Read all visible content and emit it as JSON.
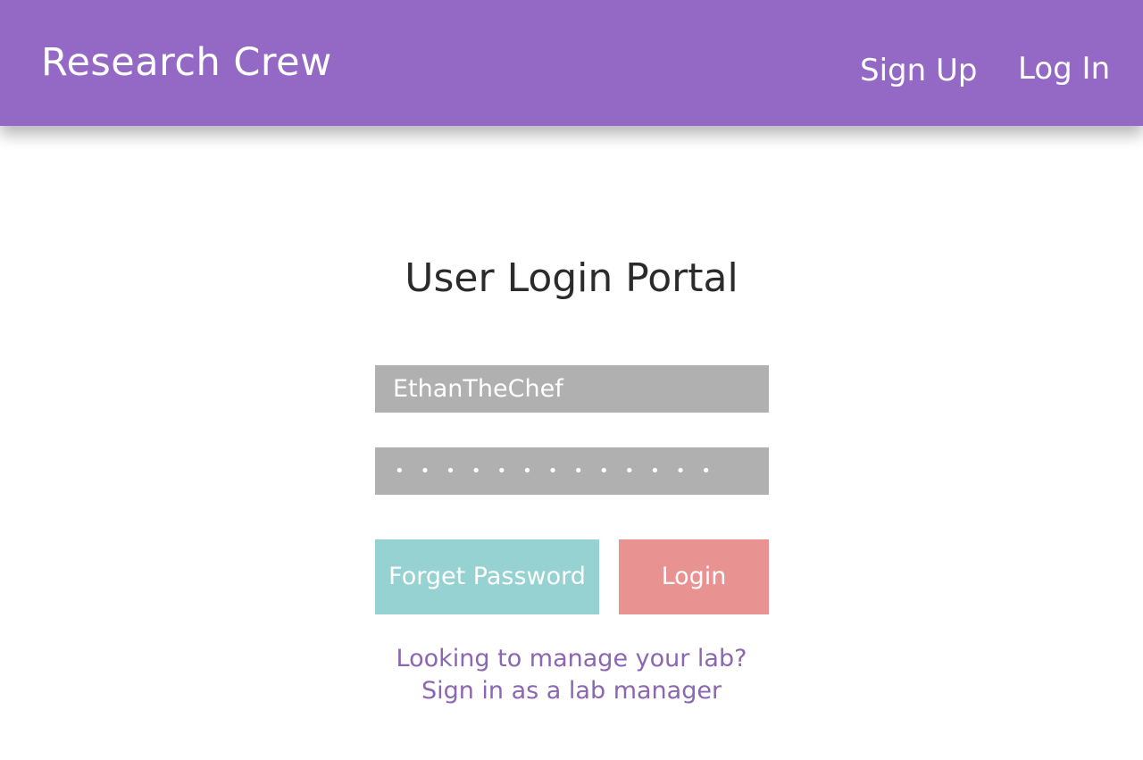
{
  "header": {
    "brand": "Research Crew",
    "nav": {
      "signup_label": "Sign Up",
      "login_label": "Log In"
    },
    "background_color": "#9469c6"
  },
  "main": {
    "title": "User Login Portal",
    "username": {
      "value": "EthanTheChef"
    },
    "password": {
      "masked_display": "•••••••••••••"
    },
    "buttons": {
      "forget_password_label": "Forget Password",
      "login_label": "Login"
    },
    "manager": {
      "prompt": "Looking to manage your lab?",
      "link": "Sign in as a lab manager"
    }
  },
  "colors": {
    "accent_purple": "#9469c6",
    "link_purple": "#8b66b2",
    "input_gray": "#b0b0b0",
    "forget_button": "#96d2d2",
    "login_button": "#e89292"
  }
}
